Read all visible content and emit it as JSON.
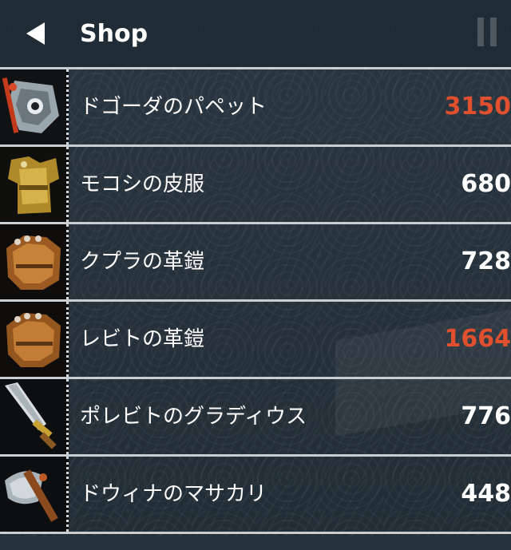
{
  "header": {
    "title": "Shop"
  },
  "items": [
    {
      "name": "ドゴーダのパペット",
      "price": "3150",
      "affordable": false,
      "icon": "puppet-icon"
    },
    {
      "name": "モコシの皮服",
      "price": "680",
      "affordable": true,
      "icon": "leather-clothes-icon"
    },
    {
      "name": "クプラの革鎧",
      "price": "728",
      "affordable": true,
      "icon": "leather-armor-icon"
    },
    {
      "name": "レビトの革鎧",
      "price": "1664",
      "affordable": false,
      "icon": "leather-armor-icon"
    },
    {
      "name": "ポレビトのグラディウス",
      "price": "776",
      "affordable": true,
      "icon": "gladius-icon"
    },
    {
      "name": "ドウィナのマサカリ",
      "price": "448",
      "affordable": true,
      "icon": "axe-icon"
    }
  ],
  "colors": {
    "unaffordable_price": "#e0502e",
    "affordable_price": "#ffffff",
    "background": "#27333d"
  }
}
